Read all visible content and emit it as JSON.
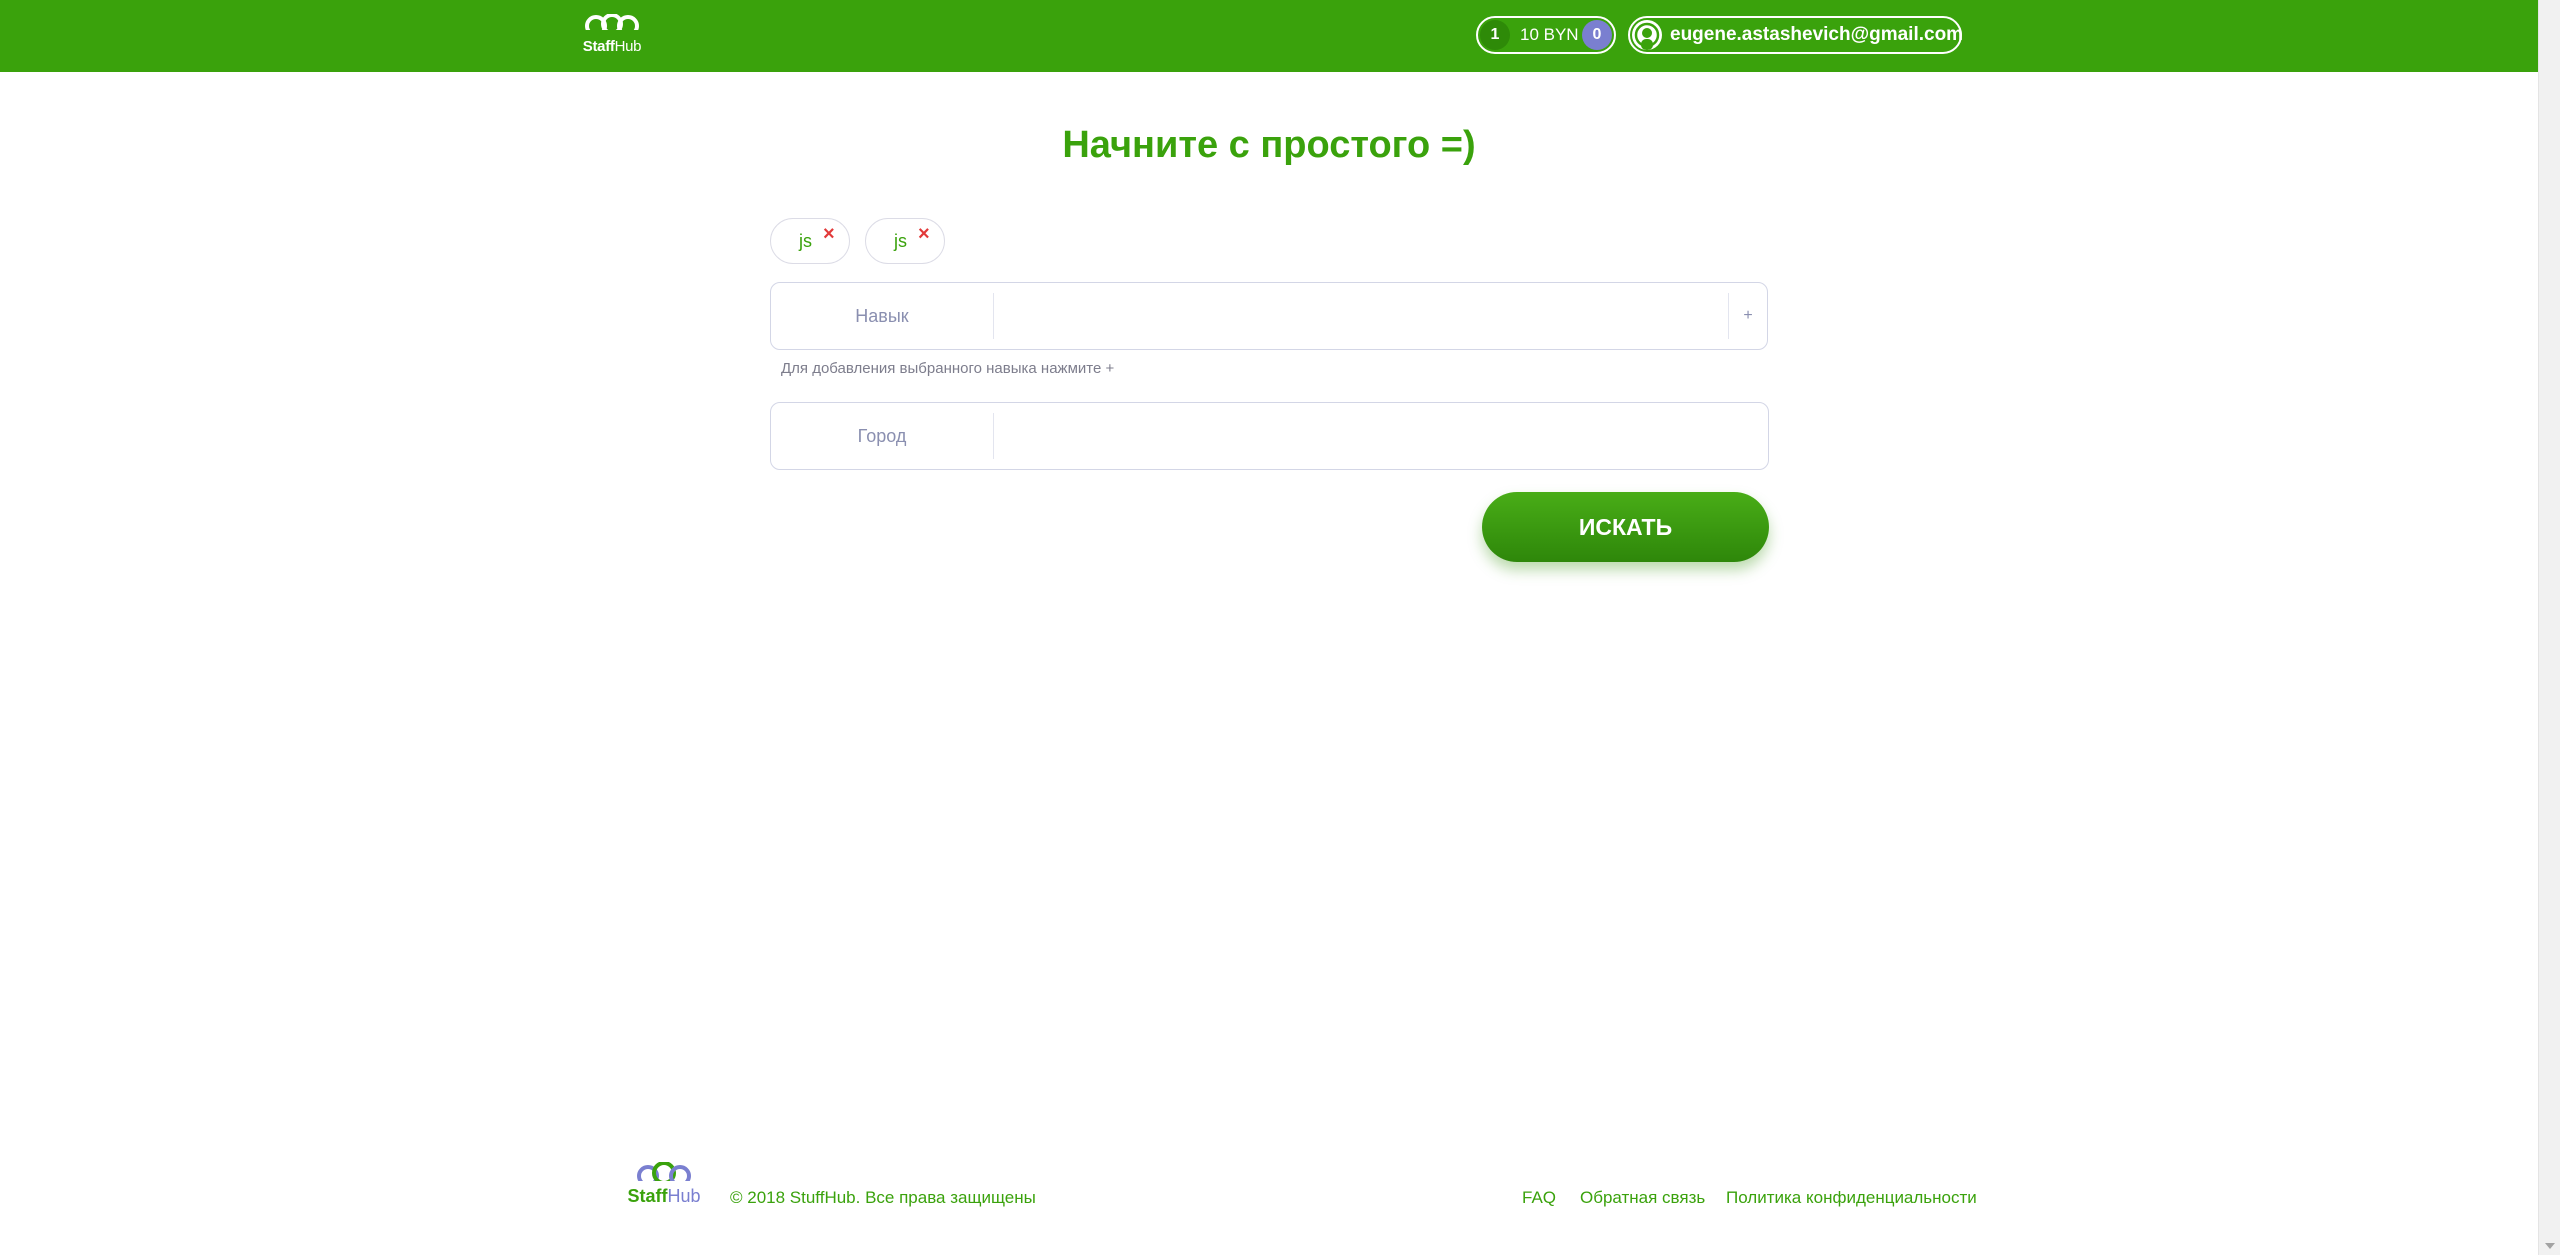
{
  "header": {
    "logo_text_staff": "Staff",
    "logo_text_hub": "Hub",
    "balance": {
      "count": "1",
      "amount": "10 BYN",
      "notifications": "0"
    },
    "account_email": "eugene.astashevich@gmail.com"
  },
  "main": {
    "title": "Начните с простого =)",
    "tags": [
      {
        "label": "js",
        "remove": "×"
      },
      {
        "label": "js",
        "remove": "×"
      }
    ],
    "skill_field": {
      "label": "Навык",
      "value": "",
      "add_button": "+"
    },
    "hint": "Для добавления выбранного навыка нажмите +",
    "city_field": {
      "label": "Город",
      "value": ""
    },
    "search_button": "ИСКАТЬ"
  },
  "footer": {
    "logo_text_staff": "Staff",
    "logo_text_hub": "Hub",
    "copyright": "© 2018 StuffHub. Все права защищены",
    "links": [
      "FAQ",
      "Обратная связь",
      "Политика конфиденциальности"
    ]
  },
  "colors": {
    "brand_green": "#3aa20c",
    "accent_purple": "#7a7fd0",
    "remove_red": "#e23a3a"
  },
  "icons": [
    "logo-icon",
    "user-avatar-icon",
    "close-icon",
    "plus-icon"
  ]
}
